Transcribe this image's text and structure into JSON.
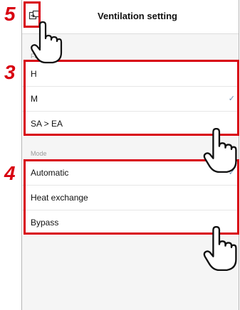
{
  "header": {
    "title": "Ventilation setting",
    "back_icon": "exit-icon"
  },
  "fan_speed": {
    "label": "Fan speed",
    "items": [
      {
        "label": "H",
        "checked": false
      },
      {
        "label": "M",
        "checked": true
      },
      {
        "label": "SA > EA",
        "checked": false
      }
    ]
  },
  "mode": {
    "label": "Mode",
    "items": [
      {
        "label": "Automatic",
        "checked": true
      },
      {
        "label": "Heat exchange",
        "checked": false
      },
      {
        "label": "Bypass",
        "checked": false
      }
    ]
  },
  "annotations": {
    "step_back": "5",
    "step_fan": "3",
    "step_mode": "4"
  },
  "colors": {
    "annotation_red": "#d8000f",
    "check_blue": "#6b8fb5"
  },
  "icons": {
    "check": "✓",
    "pointer": "hand-pointer-icon"
  }
}
